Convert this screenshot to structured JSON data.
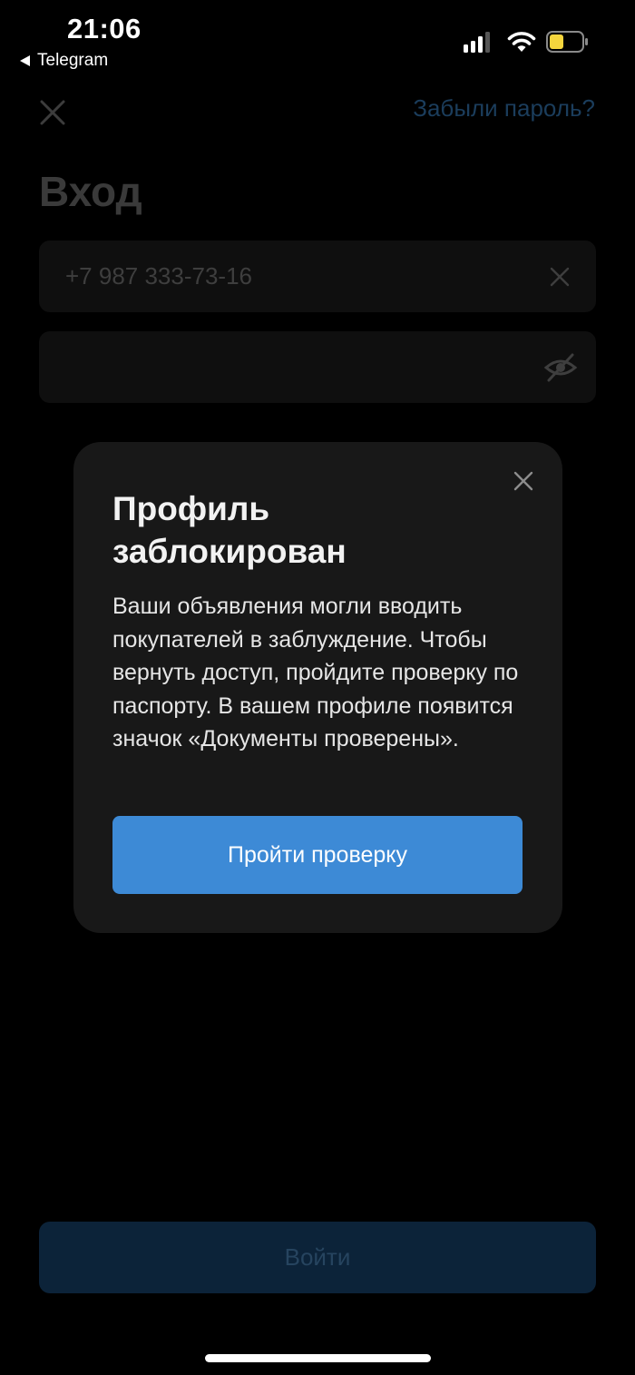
{
  "status_bar": {
    "time": "21:06",
    "back_app": "Telegram",
    "icons": [
      "signal-icon",
      "wifi-icon",
      "battery-icon"
    ],
    "battery_color": "#f5d53d"
  },
  "login": {
    "forgot_password": "Забыли пароль?",
    "title": "Вход",
    "phone_value": "+7 987 333-73-16",
    "password_value": "",
    "submit_label": "Войти"
  },
  "modal": {
    "title": "Профиль заблокирован",
    "text": "Ваши объявления могли вводить покупателей в заблуждение. Чтобы вернуть доступ, пройдите проверку по паспорту. В вашем профиле появится значок «Документы проверены».",
    "button_label": "Пройти проверку",
    "accent_color": "#3d8ad6"
  }
}
